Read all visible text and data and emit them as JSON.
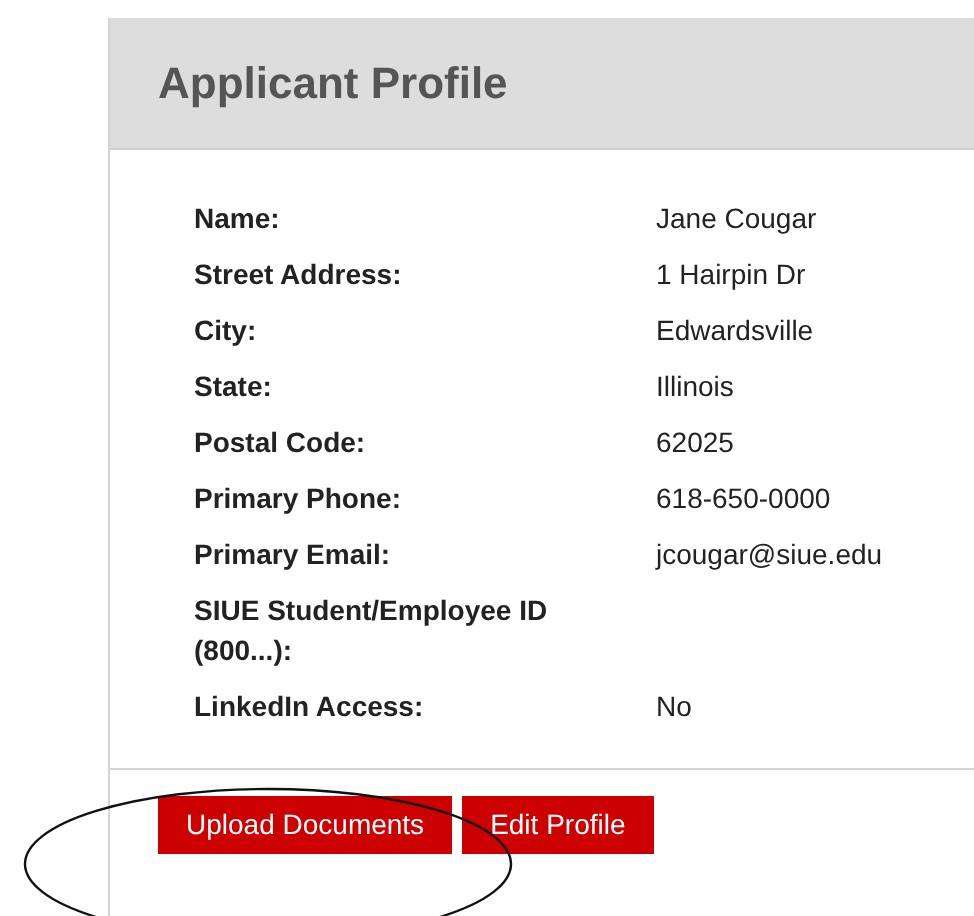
{
  "panel": {
    "title": "Applicant Profile"
  },
  "fields": [
    {
      "label": "Name:",
      "value": "Jane Cougar"
    },
    {
      "label": "Street Address:",
      "value": "1 Hairpin Dr"
    },
    {
      "label": "City:",
      "value": "Edwardsville"
    },
    {
      "label": "State:",
      "value": "Illinois"
    },
    {
      "label": "Postal Code:",
      "value": "62025"
    },
    {
      "label": "Primary Phone:",
      "value": "618-650-0000"
    },
    {
      "label": "Primary Email:",
      "value": "jcougar@siue.edu"
    },
    {
      "label": "SIUE Student/Employee ID (800...):"
    },
    {
      "label": "LinkedIn Access:",
      "value": "No"
    }
  ],
  "buttons": [
    "Upload Documents",
    "Edit Profile"
  ]
}
